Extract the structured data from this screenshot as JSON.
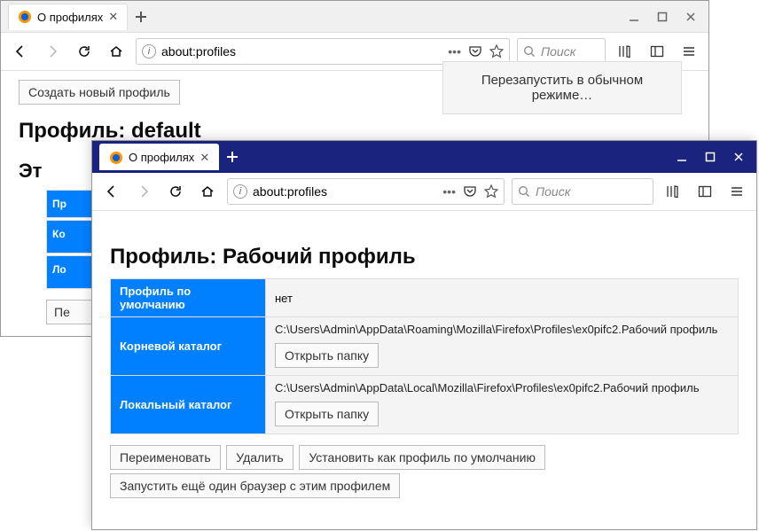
{
  "window_a": {
    "tab_title": "О профилях",
    "url": "about:profiles",
    "search_placeholder": "Поиск",
    "create_profile": "Создать новый профиль",
    "restart_normal": "Перезапустить в обычном режиме…",
    "profile_heading": "Профиль: default",
    "cut_heading": "Эт",
    "stub_labels": [
      "Пр",
      "Ко",
      "Ло"
    ],
    "stub_btn": "Пе"
  },
  "window_b": {
    "tab_title": "О профилях",
    "url": "about:profiles",
    "search_placeholder": "Поиск",
    "profile_heading": "Профиль: Рабочий профиль",
    "table": {
      "default_label": "Профиль по умолчанию",
      "default_value": "нет",
      "root_label": "Корневой каталог",
      "root_path": "C:\\Users\\Admin\\AppData\\Roaming\\Mozilla\\Firefox\\Profiles\\ex0pifc2.Рабочий профиль",
      "local_label": "Локальный каталог",
      "local_path": "C:\\Users\\Admin\\AppData\\Local\\Mozilla\\Firefox\\Profiles\\ex0pifc2.Рабочий профиль",
      "open_folder": "Открыть папку"
    },
    "actions": {
      "rename": "Переименовать",
      "delete": "Удалить",
      "set_default": "Установить как профиль по умолчанию",
      "launch": "Запустить ещё один браузер с этим профилем"
    }
  }
}
